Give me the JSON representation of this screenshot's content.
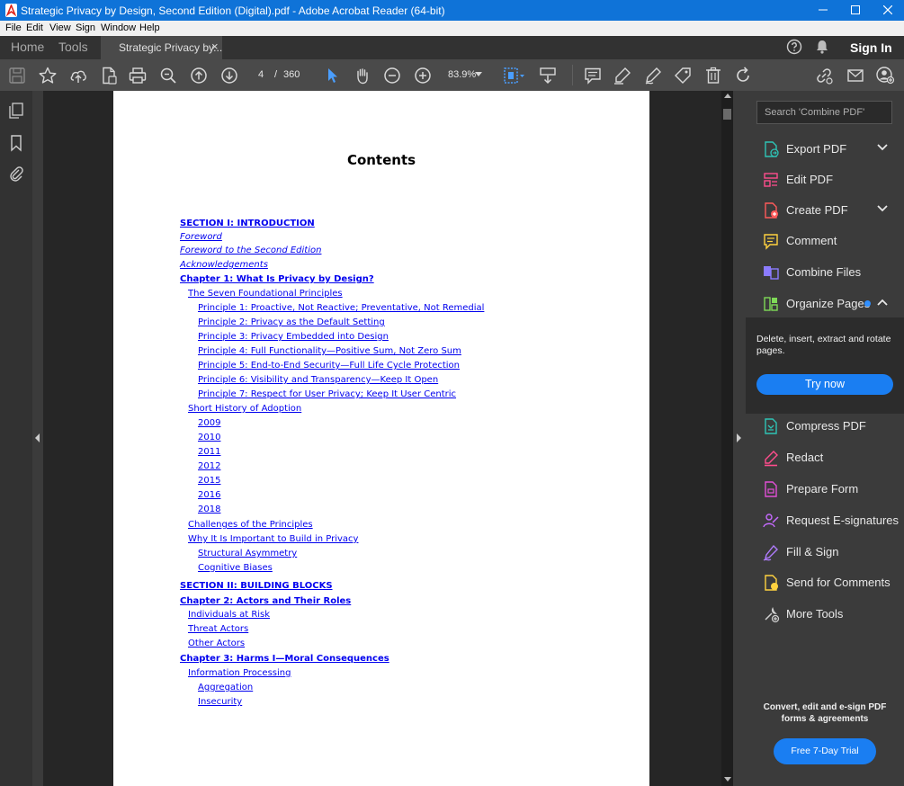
{
  "window": {
    "title": "Strategic Privacy by Design, Second Edition (Digital).pdf - Adobe Acrobat Reader (64-bit)"
  },
  "menu": [
    "File",
    "Edit",
    "View",
    "Sign",
    "Window",
    "Help"
  ],
  "tabs": {
    "home": "Home",
    "tools": "Tools",
    "doc": "Strategic Privacy by...",
    "close": "×"
  },
  "account": {
    "signin": "Sign In"
  },
  "toolbar": {
    "page_current": "4",
    "page_sep": "/",
    "page_total": "360",
    "zoom": "83.9%"
  },
  "document": {
    "heading": "Contents",
    "toc": [
      {
        "text": "SECTION I: INTRODUCTION",
        "indent": 0,
        "style": "bold"
      },
      {
        "text": "Foreword",
        "indent": 0,
        "style": "italic"
      },
      {
        "text": "Foreword to the Second Edition",
        "indent": 0,
        "style": "italic"
      },
      {
        "text": "Acknowledgements",
        "indent": 0,
        "style": "italic"
      },
      {
        "text": "Chapter 1: What Is Privacy by Design?",
        "indent": 0,
        "style": "bold"
      },
      {
        "text": "The Seven Foundational Principles",
        "indent": 1,
        "style": "normal"
      },
      {
        "text": "Principle 1: Proactive, Not Reactive; Preventative, Not Remedial",
        "indent": 2,
        "style": "normal"
      },
      {
        "text": "Principle 2: Privacy as the Default Setting",
        "indent": 2,
        "style": "normal"
      },
      {
        "text": "Principle 3: Privacy Embedded into Design",
        "indent": 2,
        "style": "normal"
      },
      {
        "text": "Principle 4: Full Functionality—Positive Sum, Not Zero Sum",
        "indent": 2,
        "style": "normal"
      },
      {
        "text": "Principle 5: End-to-End Security—Full Life Cycle Protection",
        "indent": 2,
        "style": "normal"
      },
      {
        "text": "Principle 6: Visibility and Transparency—Keep It Open",
        "indent": 2,
        "style": "normal"
      },
      {
        "text": "Principle 7: Respect for User Privacy; Keep It User Centric",
        "indent": 2,
        "style": "normal"
      },
      {
        "text": "Short History of Adoption",
        "indent": 1,
        "style": "normal"
      },
      {
        "text": "2009",
        "indent": 2,
        "style": "normal"
      },
      {
        "text": "2010",
        "indent": 2,
        "style": "normal"
      },
      {
        "text": "2011",
        "indent": 2,
        "style": "normal"
      },
      {
        "text": "2012",
        "indent": 2,
        "style": "normal"
      },
      {
        "text": "2015",
        "indent": 2,
        "style": "normal"
      },
      {
        "text": "2016",
        "indent": 2,
        "style": "normal"
      },
      {
        "text": "2018",
        "indent": 2,
        "style": "normal"
      },
      {
        "text": "Challenges of the Principles",
        "indent": 1,
        "style": "normal"
      },
      {
        "text": "Why It Is Important to Build in Privacy",
        "indent": 1,
        "style": "normal"
      },
      {
        "text": "Structural Asymmetry",
        "indent": 2,
        "style": "normal"
      },
      {
        "text": "Cognitive Biases",
        "indent": 2,
        "style": "normal"
      },
      {
        "text": "SECTION II: BUILDING BLOCKS",
        "indent": 0,
        "style": "bold"
      },
      {
        "text": "Chapter 2: Actors and Their Roles",
        "indent": 0,
        "style": "bold"
      },
      {
        "text": "Individuals at Risk",
        "indent": 1,
        "style": "normal"
      },
      {
        "text": "Threat Actors",
        "indent": 1,
        "style": "normal"
      },
      {
        "text": "Other Actors",
        "indent": 1,
        "style": "normal"
      },
      {
        "text": "Chapter 3: Harms I—Moral Consequences",
        "indent": 0,
        "style": "bold"
      },
      {
        "text": "Information Processing",
        "indent": 1,
        "style": "normal"
      },
      {
        "text": "Aggregation",
        "indent": 2,
        "style": "normal"
      },
      {
        "text": "Insecurity",
        "indent": 2,
        "style": "normal"
      }
    ]
  },
  "rightpane": {
    "search_placeholder": "Search 'Combine PDF'",
    "tools": [
      {
        "label": "Export PDF",
        "icon": "export-pdf-icon",
        "color": "#2ec4b6",
        "chevron": "down"
      },
      {
        "label": "Edit PDF",
        "icon": "edit-pdf-icon",
        "color": "#ff4d8d",
        "chevron": ""
      },
      {
        "label": "Create PDF",
        "icon": "create-pdf-icon",
        "color": "#ff5a5a",
        "chevron": "down"
      },
      {
        "label": "Comment",
        "icon": "comment-icon",
        "color": "#ffd23f",
        "chevron": ""
      },
      {
        "label": "Combine Files",
        "icon": "combine-files-icon",
        "color": "#8b7bff",
        "chevron": ""
      },
      {
        "label": "Organize Pages",
        "icon": "organize-pages-icon",
        "color": "#7ed957",
        "chevron": "up"
      },
      {
        "label": "Compress PDF",
        "icon": "compress-pdf-icon",
        "color": "#2ec4b6",
        "chevron": ""
      },
      {
        "label": "Redact",
        "icon": "redact-icon",
        "color": "#ff4d8d",
        "chevron": ""
      },
      {
        "label": "Prepare Form",
        "icon": "prepare-form-icon",
        "color": "#e14fd6",
        "chevron": ""
      },
      {
        "label": "Request E-signatures",
        "icon": "request-esignatures-icon",
        "color": "#c66bff",
        "chevron": ""
      },
      {
        "label": "Fill & Sign",
        "icon": "fill-sign-icon",
        "color": "#b07cff",
        "chevron": ""
      },
      {
        "label": "Send for Comments",
        "icon": "send-for-comments-icon",
        "color": "#ffd23f",
        "chevron": ""
      },
      {
        "label": "More Tools",
        "icon": "more-tools-icon",
        "color": "#cfcfcf",
        "chevron": ""
      }
    ],
    "organize_desc": "Delete, insert, extract and rotate pages.",
    "try_now": "Try now",
    "promo_text": "Convert, edit and e-sign PDF forms & agreements",
    "trial_button": "Free 7-Day Trial"
  },
  "colors": {
    "accent": "#1a7ef2",
    "titlebar": "#0f73d8",
    "link": "#0000ee"
  }
}
